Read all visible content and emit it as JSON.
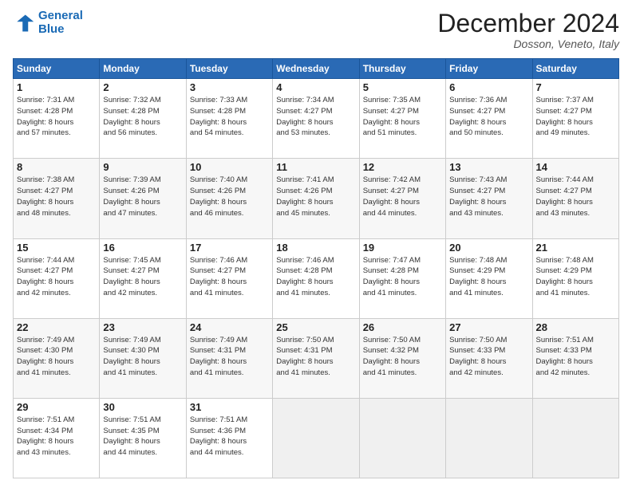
{
  "header": {
    "logo_line1": "General",
    "logo_line2": "Blue",
    "title": "December 2024",
    "location": "Dosson, Veneto, Italy"
  },
  "weekdays": [
    "Sunday",
    "Monday",
    "Tuesday",
    "Wednesday",
    "Thursday",
    "Friday",
    "Saturday"
  ],
  "weeks": [
    [
      {
        "day": "1",
        "info": "Sunrise: 7:31 AM\nSunset: 4:28 PM\nDaylight: 8 hours\nand 57 minutes."
      },
      {
        "day": "2",
        "info": "Sunrise: 7:32 AM\nSunset: 4:28 PM\nDaylight: 8 hours\nand 56 minutes."
      },
      {
        "day": "3",
        "info": "Sunrise: 7:33 AM\nSunset: 4:28 PM\nDaylight: 8 hours\nand 54 minutes."
      },
      {
        "day": "4",
        "info": "Sunrise: 7:34 AM\nSunset: 4:27 PM\nDaylight: 8 hours\nand 53 minutes."
      },
      {
        "day": "5",
        "info": "Sunrise: 7:35 AM\nSunset: 4:27 PM\nDaylight: 8 hours\nand 51 minutes."
      },
      {
        "day": "6",
        "info": "Sunrise: 7:36 AM\nSunset: 4:27 PM\nDaylight: 8 hours\nand 50 minutes."
      },
      {
        "day": "7",
        "info": "Sunrise: 7:37 AM\nSunset: 4:27 PM\nDaylight: 8 hours\nand 49 minutes."
      }
    ],
    [
      {
        "day": "8",
        "info": "Sunrise: 7:38 AM\nSunset: 4:27 PM\nDaylight: 8 hours\nand 48 minutes."
      },
      {
        "day": "9",
        "info": "Sunrise: 7:39 AM\nSunset: 4:26 PM\nDaylight: 8 hours\nand 47 minutes."
      },
      {
        "day": "10",
        "info": "Sunrise: 7:40 AM\nSunset: 4:26 PM\nDaylight: 8 hours\nand 46 minutes."
      },
      {
        "day": "11",
        "info": "Sunrise: 7:41 AM\nSunset: 4:26 PM\nDaylight: 8 hours\nand 45 minutes."
      },
      {
        "day": "12",
        "info": "Sunrise: 7:42 AM\nSunset: 4:27 PM\nDaylight: 8 hours\nand 44 minutes."
      },
      {
        "day": "13",
        "info": "Sunrise: 7:43 AM\nSunset: 4:27 PM\nDaylight: 8 hours\nand 43 minutes."
      },
      {
        "day": "14",
        "info": "Sunrise: 7:44 AM\nSunset: 4:27 PM\nDaylight: 8 hours\nand 43 minutes."
      }
    ],
    [
      {
        "day": "15",
        "info": "Sunrise: 7:44 AM\nSunset: 4:27 PM\nDaylight: 8 hours\nand 42 minutes."
      },
      {
        "day": "16",
        "info": "Sunrise: 7:45 AM\nSunset: 4:27 PM\nDaylight: 8 hours\nand 42 minutes."
      },
      {
        "day": "17",
        "info": "Sunrise: 7:46 AM\nSunset: 4:27 PM\nDaylight: 8 hours\nand 41 minutes."
      },
      {
        "day": "18",
        "info": "Sunrise: 7:46 AM\nSunset: 4:28 PM\nDaylight: 8 hours\nand 41 minutes."
      },
      {
        "day": "19",
        "info": "Sunrise: 7:47 AM\nSunset: 4:28 PM\nDaylight: 8 hours\nand 41 minutes."
      },
      {
        "day": "20",
        "info": "Sunrise: 7:48 AM\nSunset: 4:29 PM\nDaylight: 8 hours\nand 41 minutes."
      },
      {
        "day": "21",
        "info": "Sunrise: 7:48 AM\nSunset: 4:29 PM\nDaylight: 8 hours\nand 41 minutes."
      }
    ],
    [
      {
        "day": "22",
        "info": "Sunrise: 7:49 AM\nSunset: 4:30 PM\nDaylight: 8 hours\nand 41 minutes."
      },
      {
        "day": "23",
        "info": "Sunrise: 7:49 AM\nSunset: 4:30 PM\nDaylight: 8 hours\nand 41 minutes."
      },
      {
        "day": "24",
        "info": "Sunrise: 7:49 AM\nSunset: 4:31 PM\nDaylight: 8 hours\nand 41 minutes."
      },
      {
        "day": "25",
        "info": "Sunrise: 7:50 AM\nSunset: 4:31 PM\nDaylight: 8 hours\nand 41 minutes."
      },
      {
        "day": "26",
        "info": "Sunrise: 7:50 AM\nSunset: 4:32 PM\nDaylight: 8 hours\nand 41 minutes."
      },
      {
        "day": "27",
        "info": "Sunrise: 7:50 AM\nSunset: 4:33 PM\nDaylight: 8 hours\nand 42 minutes."
      },
      {
        "day": "28",
        "info": "Sunrise: 7:51 AM\nSunset: 4:33 PM\nDaylight: 8 hours\nand 42 minutes."
      }
    ],
    [
      {
        "day": "29",
        "info": "Sunrise: 7:51 AM\nSunset: 4:34 PM\nDaylight: 8 hours\nand 43 minutes."
      },
      {
        "day": "30",
        "info": "Sunrise: 7:51 AM\nSunset: 4:35 PM\nDaylight: 8 hours\nand 44 minutes."
      },
      {
        "day": "31",
        "info": "Sunrise: 7:51 AM\nSunset: 4:36 PM\nDaylight: 8 hours\nand 44 minutes."
      },
      null,
      null,
      null,
      null
    ]
  ]
}
